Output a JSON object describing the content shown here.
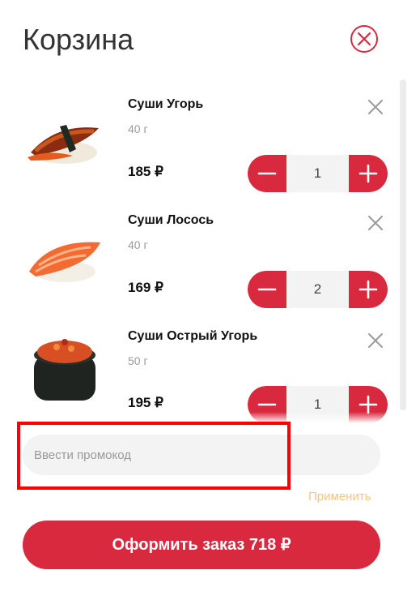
{
  "header": {
    "title": "Корзина",
    "close_icon": "close-circle-icon"
  },
  "colors": {
    "accent": "#d9293f",
    "apply_link": "#f6c57f",
    "stepper_bg": "#f3f3f3"
  },
  "cart": {
    "items": [
      {
        "name": "Суши Угорь",
        "weight": "40 г",
        "price": "185 ₽",
        "qty": "1",
        "image": "eel-sushi-image"
      },
      {
        "name": "Суши Лосось",
        "weight": "40 г",
        "price": "169 ₽",
        "qty": "2",
        "image": "salmon-sushi-image"
      },
      {
        "name": "Суши Острый Угорь",
        "weight": "50 г",
        "price": "195 ₽",
        "qty": "1",
        "image": "spicy-eel-gunkan-image"
      }
    ]
  },
  "promo": {
    "placeholder": "Ввести промокод",
    "value": "",
    "apply_label": "Применить"
  },
  "checkout": {
    "label": "Оформить заказ 718 ₽"
  }
}
